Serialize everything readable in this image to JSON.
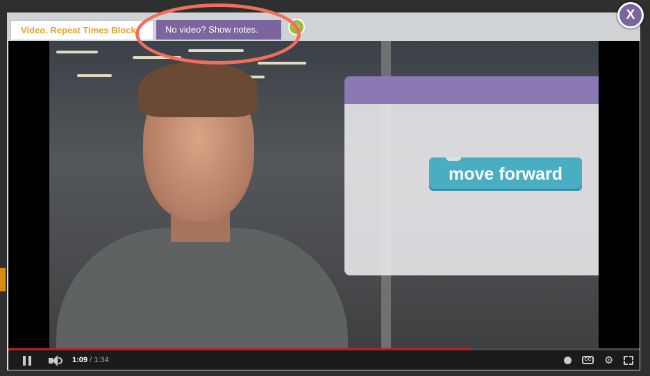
{
  "tabs": {
    "video_label": "Video. Repeat Times Block",
    "notes_label": "No video? Show notes.",
    "add_label": "+"
  },
  "close_label": "X",
  "video": {
    "overlay_block_label": "move forward"
  },
  "player": {
    "current_time": "1:09",
    "separator": "/",
    "duration": "1:34",
    "progress_fraction": 0.734,
    "cc_label": "CC",
    "gear_glyph": "⚙"
  },
  "colors": {
    "tab_accent": "#e7a128",
    "purple": "#7a659e",
    "annotation": "#f26d5b",
    "progress": "#cc181e",
    "code_block": "#4aaec3"
  },
  "icons": [
    "pause-icon",
    "volume-icon",
    "clock-icon",
    "cc-icon",
    "gear-icon",
    "fullscreen-icon",
    "close-icon",
    "add-icon"
  ]
}
